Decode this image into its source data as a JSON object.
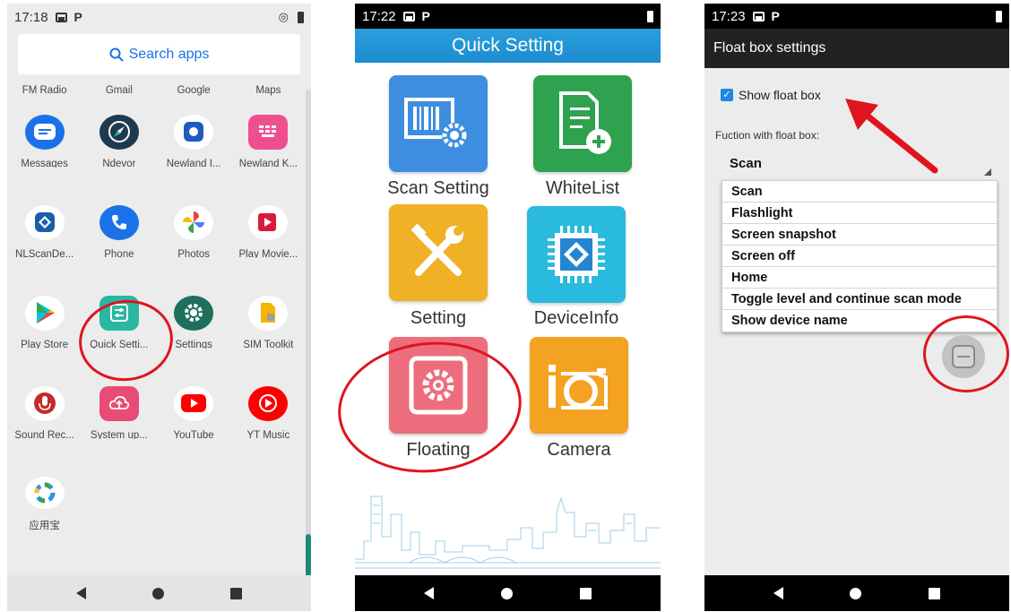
{
  "p1": {
    "status": {
      "time": "17:18"
    },
    "search": {
      "label": "Search apps"
    },
    "rows": [
      [
        "FM Radio",
        "Gmail",
        "Google",
        "Maps"
      ],
      [
        "Messages",
        "Ndevor",
        "Newland I...",
        "Newland K..."
      ],
      [
        "NLScanDe...",
        "Phone",
        "Photos",
        "Play Movie..."
      ],
      [
        "Play Store",
        "Quick Setti...",
        "Settings",
        "SIM Toolkit"
      ],
      [
        "Sound Rec...",
        "System up...",
        "YouTube",
        "YT Music"
      ],
      [
        "应用宝"
      ]
    ]
  },
  "p2": {
    "status": {
      "time": "17:22"
    },
    "title": "Quick Setting",
    "tiles": [
      "Scan Setting",
      "WhiteList",
      "Setting",
      "DeviceInfo",
      "Floating",
      "Camera"
    ]
  },
  "p3": {
    "status": {
      "time": "17:23"
    },
    "title": "Float box settings",
    "show_label": "Show float box",
    "fn_label": "Fuction with float box:",
    "selected": "Scan",
    "options": [
      "Scan",
      "Flashlight",
      "Screen snapshot",
      "Screen off",
      "Home",
      "Toggle level and continue scan mode",
      "Show device name"
    ]
  },
  "colors": {
    "annotation": "#e0141e",
    "quick_header": "#1d8bd0"
  }
}
